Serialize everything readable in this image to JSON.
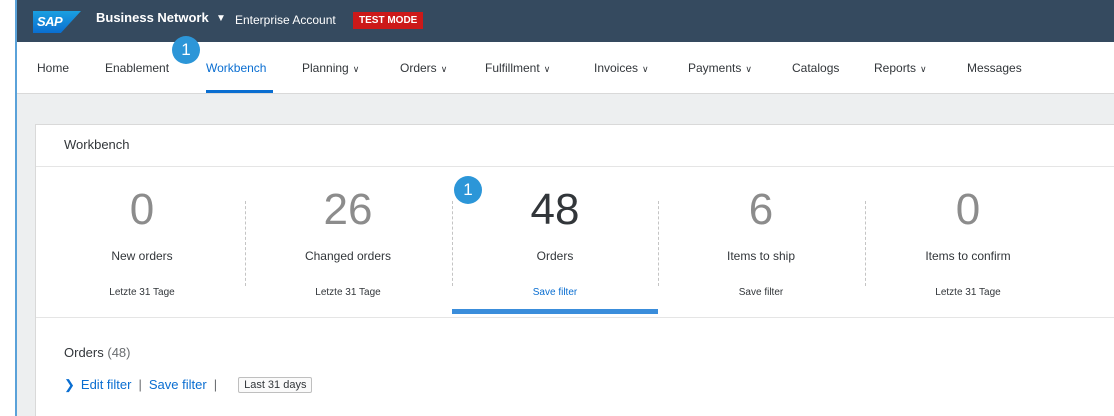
{
  "shell": {
    "logo": "SAP",
    "product": "Business Network",
    "account": "Enterprise Account",
    "test_mode": "TEST MODE"
  },
  "nav": [
    {
      "label": "Home",
      "dropdown": false
    },
    {
      "label": "Enablement",
      "dropdown": false
    },
    {
      "label": "Workbench",
      "dropdown": false,
      "active": true
    },
    {
      "label": "Planning",
      "dropdown": true
    },
    {
      "label": "Orders",
      "dropdown": true
    },
    {
      "label": "Fulfillment",
      "dropdown": true
    },
    {
      "label": "Invoices",
      "dropdown": true
    },
    {
      "label": "Payments",
      "dropdown": true
    },
    {
      "label": "Catalogs",
      "dropdown": false
    },
    {
      "label": "Reports",
      "dropdown": true
    },
    {
      "label": "Messages",
      "dropdown": false
    }
  ],
  "callouts": [
    "1",
    "1"
  ],
  "workbench": {
    "title": "Workbench",
    "tiles": [
      {
        "value": "0",
        "label": "New orders",
        "sub": "Letzte 31 Tage"
      },
      {
        "value": "26",
        "label": "Changed orders",
        "sub": "Letzte 31 Tage"
      },
      {
        "value": "48",
        "label": "Orders",
        "sub": "Save filter",
        "selected": true
      },
      {
        "value": "6",
        "label": "Items to ship",
        "sub": "Save filter"
      },
      {
        "value": "0",
        "label": "Items to confirm",
        "sub": "Letzte 31 Tage"
      }
    ]
  },
  "orders": {
    "title": "Orders",
    "count": "(48)",
    "edit_filter": "Edit filter",
    "save_filter": "Save filter",
    "separator": "|",
    "range": "Last 31 days"
  },
  "colors": {
    "shell_bg": "#354a5f",
    "accent": "#0a6ed1",
    "test_mode": "#cc1919",
    "callout": "#2c96d8"
  }
}
